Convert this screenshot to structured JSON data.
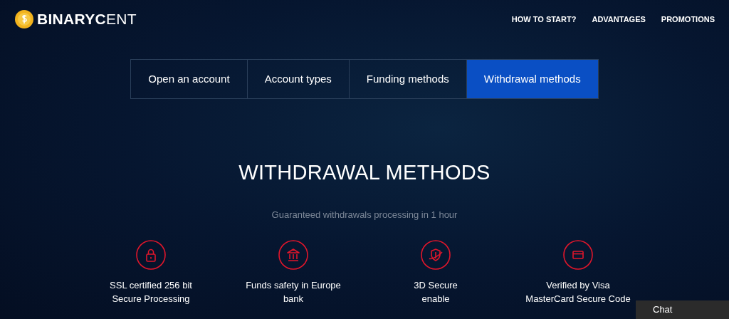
{
  "brand": {
    "bold": "BINARYC",
    "light": "ENT"
  },
  "nav": [
    "HOW TO START?",
    "ADVANTAGES",
    "PROMOTIONS"
  ],
  "tabs": [
    {
      "label": "Open an account",
      "selected": false
    },
    {
      "label": "Account types",
      "selected": false
    },
    {
      "label": "Funding methods",
      "selected": false
    },
    {
      "label": "Withdrawal methods",
      "selected": true
    }
  ],
  "heading": "WITHDRAWAL METHODS",
  "subtitle": "Guaranteed withdrawals processing in 1 hour",
  "features": [
    {
      "lines": [
        "SSL certified 256 bit",
        "Secure Processing"
      ]
    },
    {
      "lines": [
        "Funds safety in Europe",
        "bank"
      ]
    },
    {
      "lines": [
        "3D Secure",
        "enable"
      ]
    },
    {
      "lines": [
        "Verified by Visa",
        "MasterCard Secure Code"
      ]
    }
  ],
  "chat": "Chat"
}
